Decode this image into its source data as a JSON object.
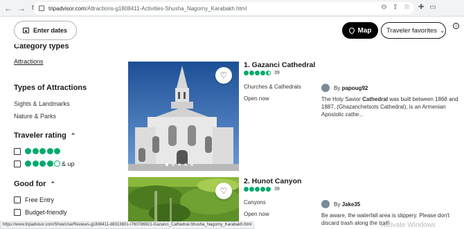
{
  "browser": {
    "url_host": "tripadvisor.com",
    "url_path": "/Attractions-g1808411-Activities-Shusha_Nagorny_Karabakh.html",
    "status_url": "https://www.tripadvisor.com/ShowUserReviews-g1808411-d8313601-r760786921-Gazanci_Cathedral-Shusha_Nagorny_Karabakh.html",
    "watermark": "Activate Windows"
  },
  "header": {
    "enter_dates": "Enter dates",
    "map": "Map",
    "sort": "Traveler favorites"
  },
  "sidebar": {
    "category_types": "Category types",
    "attractions": "Attractions",
    "types_title": "Types of Attractions",
    "types": [
      "Sights & Landmarks",
      "Nature & Parks"
    ],
    "rating_title": "Traveler rating",
    "and_up": "& up",
    "good_for_title": "Good for",
    "good_for": [
      "Free Entry",
      "Budget-friendly"
    ]
  },
  "colors": {
    "bubble": "#00aa6c"
  },
  "results": [
    {
      "title": "1. Gazanci Cathedral",
      "rating": 4.5,
      "reviews": "39",
      "category": "Churches & Cathedrals",
      "status": "Open now",
      "review_by": "papoug92",
      "review_prefix": "By ",
      "review_text_a": "The Holy Savior ",
      "review_text_bold": "Cathedral",
      "review_text_b": " was built between 1868 and 1887, (Ghazanchetsots Cathedral), is an Armenian Apostolic cathe..."
    },
    {
      "title": "2. Hunot Canyon",
      "rating": 5,
      "reviews": "39",
      "category": "Canyons",
      "status": "Open now",
      "review_by": "Jake35",
      "review_prefix": "By ",
      "review_text": "Be aware, the waterfall area is slippery. Please don't discard trash along the trail!"
    }
  ]
}
